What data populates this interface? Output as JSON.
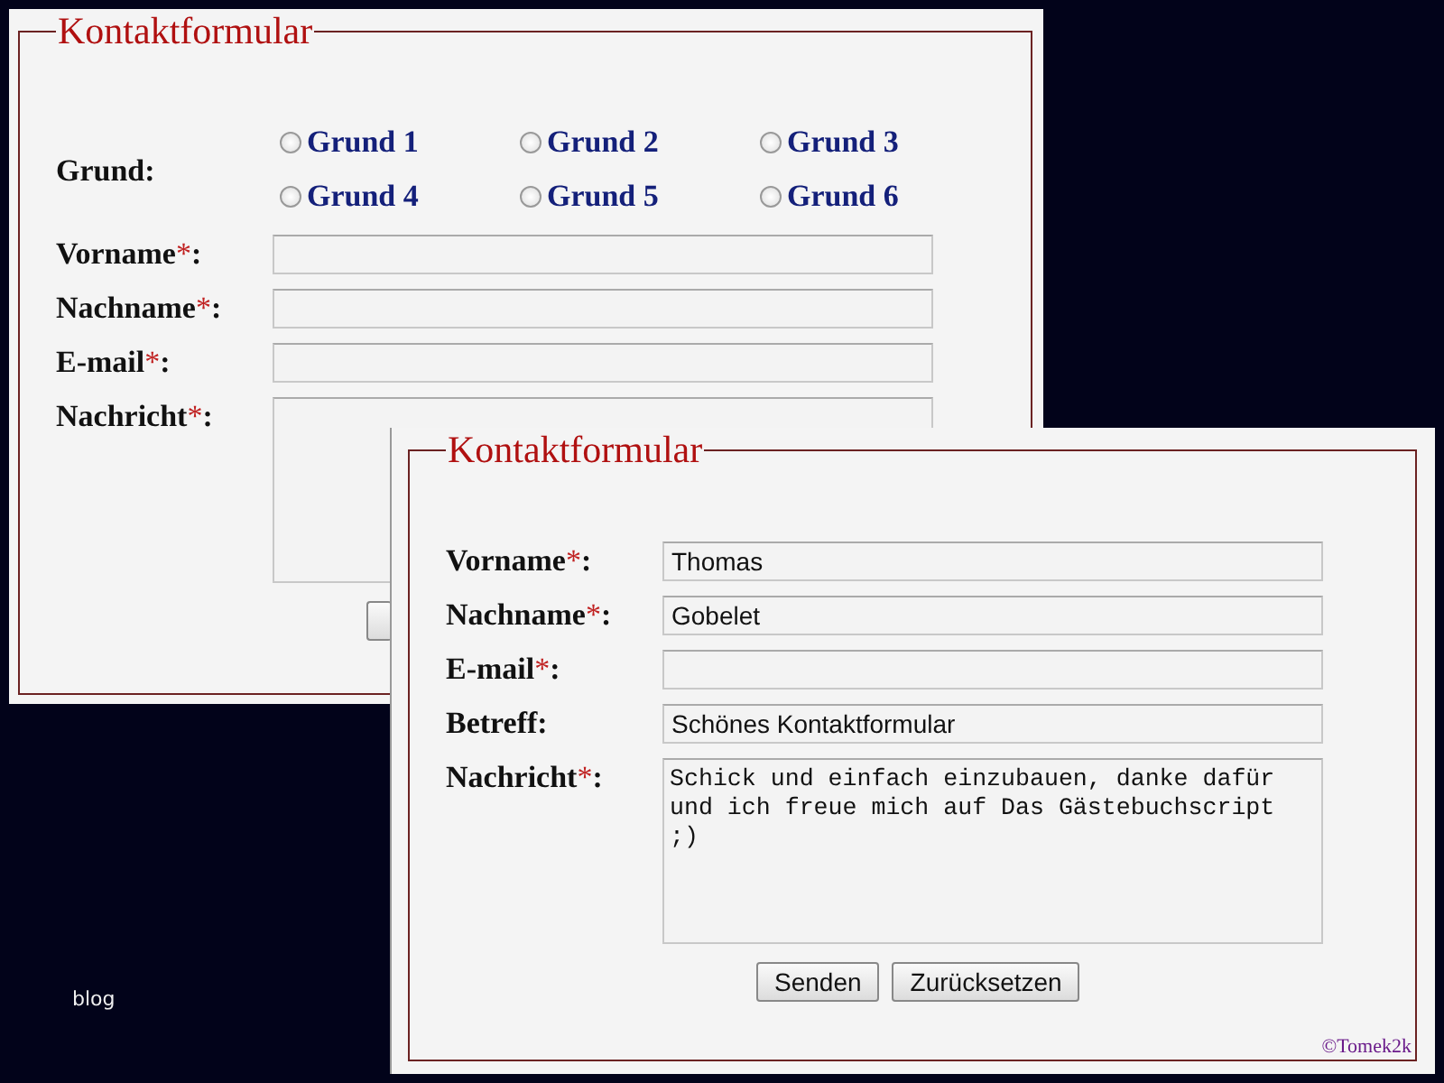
{
  "background_link": "blog",
  "forms": [
    {
      "legend": "Kontaktformular",
      "reason": {
        "label": "Grund:",
        "options": [
          {
            "label": "Grund 1",
            "selected": false
          },
          {
            "label": "Grund 2",
            "selected": false
          },
          {
            "label": "Grund 3",
            "selected": false
          },
          {
            "label": "Grund 4",
            "selected": false
          },
          {
            "label": "Grund 5",
            "selected": false
          },
          {
            "label": "Grund 6",
            "selected": false
          }
        ]
      },
      "fields": [
        {
          "kind": "text",
          "label": "Vorname",
          "mark": "*",
          "colon": ":"
        },
        {
          "kind": "text",
          "label": "Nachname",
          "mark": "*",
          "colon": ":"
        },
        {
          "kind": "text",
          "label": "E-mail",
          "mark": "*",
          "colon": ":"
        },
        {
          "kind": "textarea",
          "label": "Nachricht",
          "mark": "*",
          "colon": ":"
        }
      ],
      "buttons": [
        {
          "kind": "covered"
        }
      ]
    },
    {
      "legend": "Kontaktformular",
      "fields": [
        {
          "kind": "text",
          "label": "Vorname",
          "mark": "*",
          "colon": ":",
          "value": "Thomas"
        },
        {
          "kind": "text",
          "label": "Nachname",
          "mark": "*",
          "colon": ":",
          "value": "Gobelet"
        },
        {
          "kind": "text",
          "label": "E-mail",
          "mark": "*",
          "colon": ":"
        },
        {
          "kind": "text",
          "label": "Betreff",
          "colon": ":",
          "value": "Schönes Kontaktformular"
        },
        {
          "kind": "textarea",
          "label": "Nachricht",
          "mark": "*",
          "colon": ":",
          "value": "Schick und einfach einzubauen, danke dafür und ich freue mich auf Das Gästebuchscript ;)"
        }
      ],
      "buttons": [
        {
          "kind": "button",
          "label": "Senden"
        },
        {
          "kind": "button",
          "label": "Zurücksetzen"
        }
      ],
      "credit": "©Tomek2k"
    }
  ]
}
